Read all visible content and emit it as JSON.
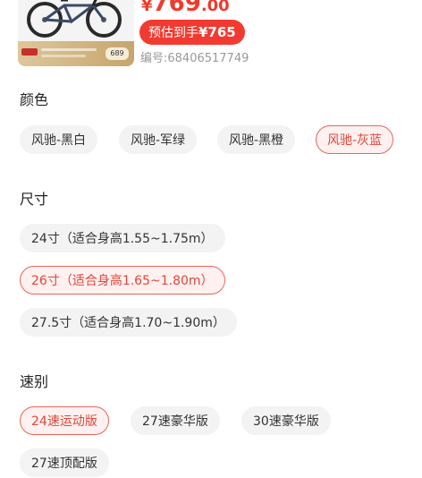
{
  "header": {
    "price": {
      "currency": "¥",
      "integer": "769",
      "decimal": ".00"
    },
    "estimated": {
      "label": "预估到手",
      "value": "¥765"
    },
    "item_number": "编号:68406517749",
    "thumbnail_badge": "689"
  },
  "colors": {
    "accent": "#f23a30",
    "selected_border": "#e7655c",
    "selected_text": "#e0463b",
    "chip_bg": "#f3f3f3",
    "muted_text": "#999999"
  },
  "color_section": {
    "title": "颜色",
    "options": [
      {
        "label": "风驰-黑白",
        "selected": false
      },
      {
        "label": "风驰-军绿",
        "selected": false
      },
      {
        "label": "风驰-黑橙",
        "selected": false
      },
      {
        "label": "风驰-灰蓝",
        "selected": true
      }
    ]
  },
  "size_section": {
    "title": "尺寸",
    "options": [
      {
        "label": "24寸（适合身高1.55~1.75m）",
        "selected": false
      },
      {
        "label": "26寸（适合身高1.65~1.80m）",
        "selected": true
      },
      {
        "label": "27.5寸（适合身高1.70~1.90m）",
        "selected": false
      }
    ]
  },
  "speed_section": {
    "title": "速别",
    "options": [
      {
        "label": "24速运动版",
        "selected": true
      },
      {
        "label": "27速豪华版",
        "selected": false
      },
      {
        "label": "30速豪华版",
        "selected": false
      },
      {
        "label": "27速顶配版",
        "selected": false
      }
    ]
  }
}
